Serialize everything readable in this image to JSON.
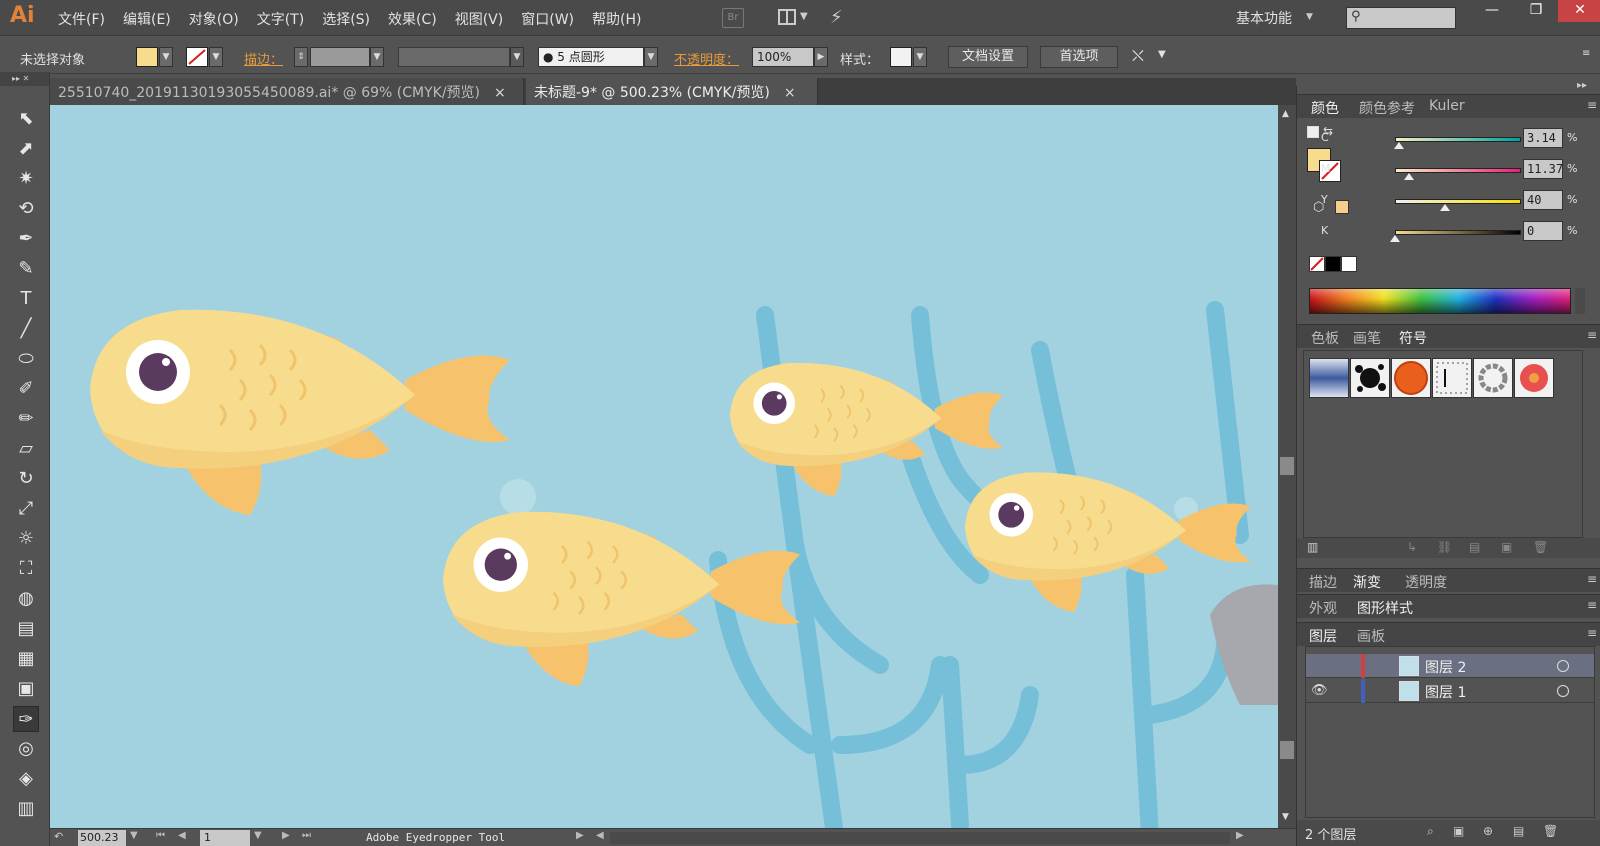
{
  "app": {
    "logo": "Ai"
  },
  "menu": [
    "文件(F)",
    "编辑(E)",
    "对象(O)",
    "文字(T)",
    "选择(S)",
    "效果(C)",
    "视图(V)",
    "窗口(W)",
    "帮助(H)"
  ],
  "header": {
    "br_label": "Br",
    "workspace": "基本功能"
  },
  "window_buttons": {
    "minimize": "—",
    "restore": "❐",
    "close": "✕"
  },
  "control": {
    "selection": "未选择对象",
    "fill_color": "#f7dc8e",
    "stroke_label": "描边：",
    "brush": "● 5 点圆形",
    "opacity_label": "不透明度：",
    "opacity_value": "100%",
    "style_label": "样式：",
    "doc_setup": "文档设置",
    "prefs": "首选项"
  },
  "tabs": [
    {
      "label": "25510740_20191130193055450089.ai* @ 69% (CMYK/预览)",
      "active": false
    },
    {
      "label": "未标题-9* @ 500.23% (CMYK/预览)",
      "active": true
    }
  ],
  "tools": [
    "selection-tool",
    "direct-selection-tool",
    "magic-wand-tool",
    "lasso-tool",
    "pen-tool",
    "curvature-tool",
    "type-tool",
    "line-tool",
    "ellipse-tool",
    "paintbrush-tool",
    "pencil-tool",
    "eraser-tool",
    "rotate-tool",
    "scale-tool",
    "warp-tool",
    "free-transform-tool",
    "shape-builder-tool",
    "graph-tool",
    "mesh-tool",
    "gradient-tool",
    "eyedropper-tool",
    "blend-tool",
    "symbol-sprayer-tool",
    "column-graph-tool"
  ],
  "tool_glyphs": [
    "⬉",
    "⬈",
    "✷",
    "⟲",
    "✒",
    "✎",
    "T",
    "╱",
    "⬭",
    "✐",
    "✏",
    "▱",
    "↻",
    "⤢",
    "☼",
    "⛶",
    "◍",
    "▤",
    "▦",
    "▣",
    "✑",
    "◎",
    "◈",
    "▥"
  ],
  "status": {
    "zoom": "500.23",
    "page": "1",
    "tool_name": "Adobe Eyedropper Tool",
    "nav": [
      "⏮",
      "◀",
      "▶",
      "⏭"
    ]
  },
  "color_panel": {
    "tabs": [
      "颜色",
      "颜色参考",
      "Kuler"
    ],
    "sliders": [
      {
        "label": "C",
        "value": "3.14",
        "fraction": 0.03,
        "grad": "linear-gradient(90deg,#f7efc2,#00a0a0)"
      },
      {
        "label": "M",
        "value": "11.37",
        "fraction": 0.11,
        "grad": "linear-gradient(90deg,#f7efc2,#e8207a)"
      },
      {
        "label": "Y",
        "value": "40",
        "fraction": 0.4,
        "grad": "linear-gradient(90deg,#f0f0f0,#f7e000)"
      },
      {
        "label": "K",
        "value": "0",
        "fraction": 0.0,
        "grad": "linear-gradient(90deg,#f7dc8e,#000)"
      }
    ],
    "pct": "%"
  },
  "symbols_panel": {
    "tabs": [
      "色板",
      "画笔",
      "符号"
    ]
  },
  "gradient_panel": {
    "tabs": [
      "描边",
      "渐变",
      "透明度"
    ]
  },
  "appearance_panel": {
    "tabs": [
      "外观",
      "图形样式"
    ]
  },
  "layers_panel": {
    "tabs": [
      "图层",
      "画板"
    ],
    "layers": [
      {
        "name": "图层 2",
        "selected": true
      },
      {
        "name": "图层 1",
        "selected": false
      }
    ],
    "count": "2 个图层"
  },
  "colors": {
    "fish_body": "#f8dc8e",
    "fish_fin": "#f6c36c",
    "fish_scale": "#f3cc76",
    "eye": "#5a3a5e",
    "seaweed": "#72bcd6",
    "water": "#a2d2e0"
  }
}
